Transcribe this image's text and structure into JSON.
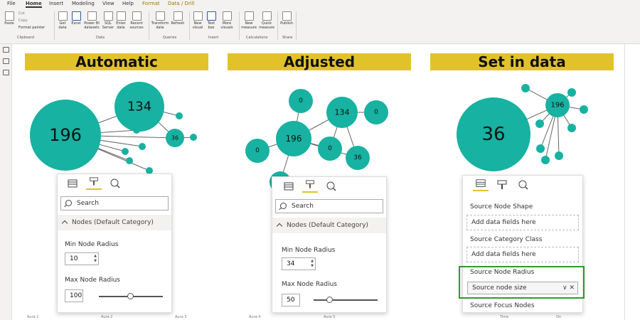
{
  "ribbon": {
    "tabs": [
      "File",
      "Home",
      "Insert",
      "Modeling",
      "View",
      "Help",
      "Format",
      "Data / Drill"
    ],
    "active_tab": "Home",
    "clipboard": {
      "paste": "Paste",
      "cut": "Cut",
      "copy": "Copy",
      "format_painter": "Format painter",
      "group": "Clipboard"
    },
    "data_buttons": [
      "Get data",
      "Excel",
      "Power BI datasets",
      "SQL Server",
      "Enter data",
      "Recent sources"
    ],
    "data_group": "Data",
    "queries_buttons": [
      "Transform data",
      "Refresh"
    ],
    "queries_group": "Queries",
    "insert_buttons": [
      "New visual",
      "Text box",
      "More visuals"
    ],
    "insert_group": "Insert",
    "calc_buttons": [
      "New measure",
      "Quick measure"
    ],
    "calc_group": "Calculations",
    "share_buttons": [
      "Publish"
    ],
    "share_group": "Share"
  },
  "panels": [
    {
      "title": "Automatic"
    },
    {
      "title": "Adjusted"
    },
    {
      "title": "Set in data"
    }
  ],
  "graphs": {
    "automatic": {
      "labels": [
        "196",
        "134",
        "36"
      ]
    },
    "adjusted": {
      "labels": [
        "196",
        "134",
        "36",
        "0",
        "0",
        "0",
        "0"
      ]
    },
    "set_in_data": {
      "labels": [
        "36",
        "196"
      ]
    }
  },
  "format_pane_1": {
    "search_placeholder": "Search",
    "section": "Nodes (Default Category)",
    "min_label": "Min Node Radius",
    "min_value": "10",
    "max_label": "Max Node Radius",
    "max_value": "100",
    "max_slider_fraction": 0.5
  },
  "format_pane_2": {
    "search_placeholder": "Search",
    "section": "Nodes (Default Category)",
    "min_label": "Min Node Radius",
    "min_value": "34",
    "max_label": "Max Node Radius",
    "max_value": "50",
    "max_slider_fraction": 0.2
  },
  "fields_pane": {
    "shape_label": "Source Node Shape",
    "shape_placeholder": "Add data fields here",
    "class_label": "Source Category Class",
    "class_placeholder": "Add data fields here",
    "radius_label": "Source Node Radius",
    "radius_field": "Source node size",
    "focus_label": "Source Focus Nodes"
  },
  "bottom_labels": [
    "Aura 1",
    "Aura 2",
    "Aura 3",
    "Aura 4",
    "Aura 5",
    "Time",
    "On"
  ],
  "colors": {
    "node": "#17b2a1",
    "banner": "#e2c22b",
    "highlight": "#2e9a2e",
    "accent_tab": "#a0720a"
  }
}
